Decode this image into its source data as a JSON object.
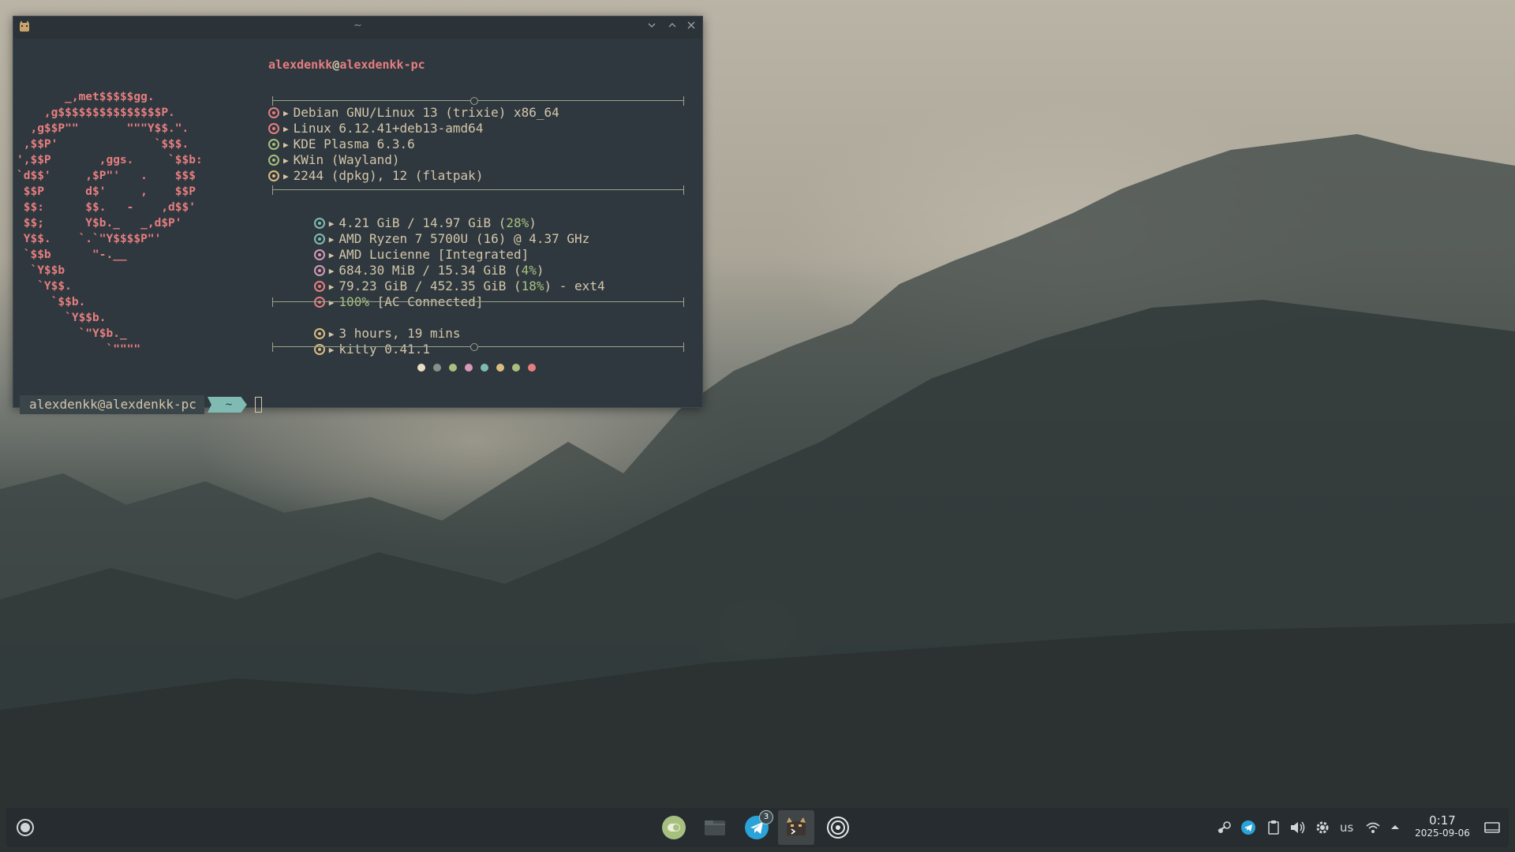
{
  "window": {
    "title": "~"
  },
  "fetch": {
    "user": "alexdenkk",
    "at": "@",
    "host": "alexdenkk-pc",
    "ascii_logo": "       _,met$$$$$gg.\n    ,g$$$$$$$$$$$$$$$P.\n  ,g$$P\"\"       \"\"\"Y$$.\".\n ,$$P'              `$$$.\n',$$P       ,ggs.     `$$b:\n`d$$'     ,$P\"'   .    $$$\n $$P      d$'     ,    $$P\n $$:      $$.   -    ,d$$'\n $$;      Y$b._   _,d$P'\n Y$$.    `.`\"Y$$$$P\"'\n `$$b      \"-.__\n  `Y$$b\n   `Y$$.\n     `$$b.\n       `Y$$b.\n         `\"Y$b._\n             `\"\"\"\"",
    "rows_group1": [
      {
        "color": "#e67e80",
        "text": "Debian GNU/Linux 13 (trixie) x86_64"
      },
      {
        "color": "#e67e80",
        "text": "Linux 6.12.41+deb13-amd64"
      },
      {
        "color": "#a7c080",
        "text": "KDE Plasma 6.3.6"
      },
      {
        "color": "#a7c080",
        "text": "KWin (Wayland)"
      },
      {
        "color": "#dbbc7f",
        "text": "2244 (dpkg), 12 (flatpak)"
      }
    ],
    "memory": {
      "pre": "4.21 GiB / 14.97 GiB (",
      "pct": "28%",
      "post": ")"
    },
    "cpu": "AMD Ryzen 7 5700U (16) @ 4.37 GHz",
    "gpu": "AMD Lucienne [Integrated]",
    "swap": {
      "pre": "684.30 MiB / 15.34 GiB (",
      "pct": "4%",
      "post": ")"
    },
    "disk": {
      "pre": "79.23 GiB / 452.35 GiB (",
      "pct": "18%",
      "post": ") - ext4"
    },
    "battery": {
      "pct": "100%",
      "post": " [AC Connected]"
    },
    "uptime": "3 hours, 19 mins",
    "terminal": "kitty 0.41.1",
    "row_colors": {
      "memory": "#7fbbb3",
      "cpu": "#7fbbb3",
      "gpu": "#d699b6",
      "swap": "#d699b6",
      "disk": "#e67e80",
      "battery": "#e67e80",
      "uptime": "#dbbc7f",
      "terminal": "#dbbc7f"
    },
    "palette": [
      "#e9dfc4",
      "#859289",
      "#a7c080",
      "#d699b6",
      "#7fbbb3",
      "#dbbc7f",
      "#a7c080",
      "#e67e80"
    ]
  },
  "prompt": {
    "user_host": "alexdenkk@alexdenkk-pc",
    "dir": "~"
  },
  "taskbar": {
    "apps": [
      "toggle-app-icon",
      "file-manager-icon",
      "telegram-icon",
      "terminal-icon",
      "steam-like-icon"
    ],
    "telegram_badge": "3",
    "tray": {
      "keyboard_layout": "us"
    },
    "clock": {
      "time": "0:17",
      "date": "2025-09-06"
    }
  }
}
